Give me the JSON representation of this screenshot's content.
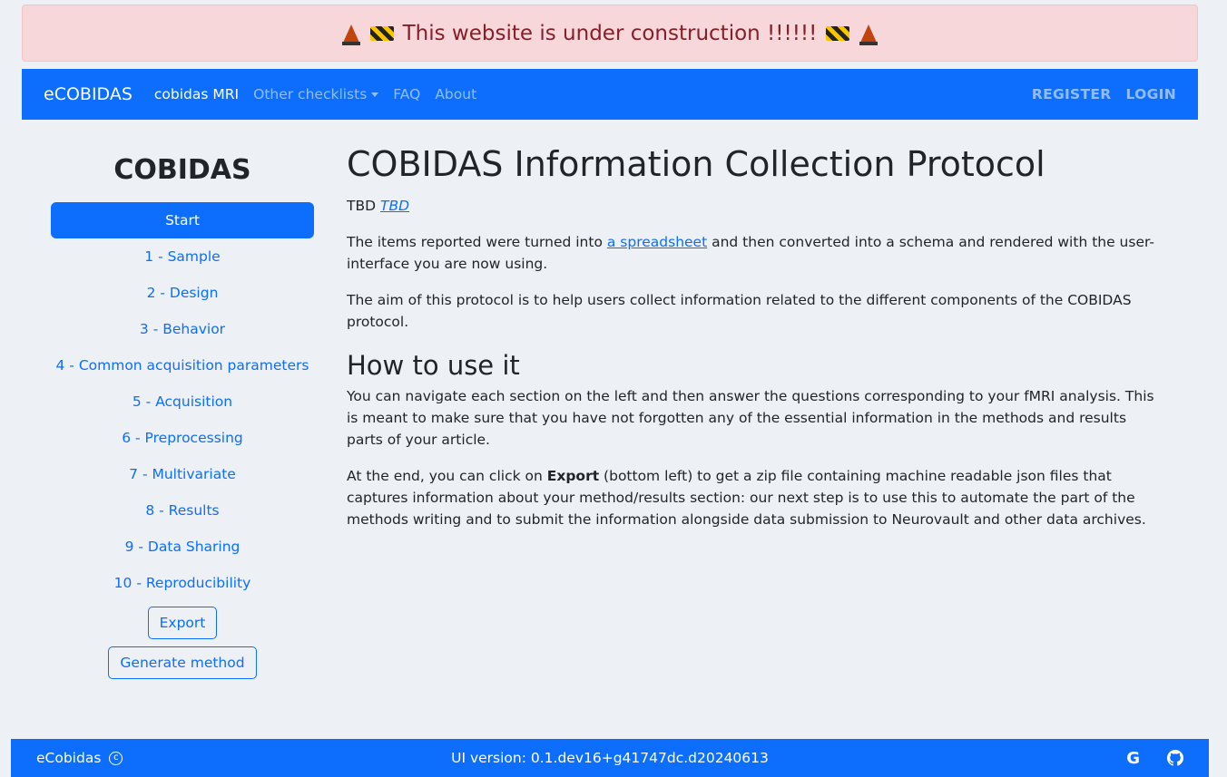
{
  "banner": {
    "text": "This website is under construction !!!!!!"
  },
  "navbar": {
    "brand": "eCOBIDAS",
    "links": [
      "cobidas MRI",
      "Other checklists",
      "FAQ",
      "About"
    ],
    "register": "REGISTER",
    "login": "LOGIN"
  },
  "sidebar": {
    "title": "COBIDAS",
    "items": [
      "Start",
      "1 - Sample",
      "2 - Design",
      "3 - Behavior",
      "4 - Common acquisition parameters",
      "5 - Acquisition",
      "6 - Preprocessing",
      "7 - Multivariate",
      "8 - Results",
      "9 - Data Sharing",
      "10 - Reproducibility"
    ],
    "export_label": "Export",
    "generate_label": "Generate method"
  },
  "main": {
    "title": "COBIDAS Information Collection Protocol",
    "tbd_text": "TBD",
    "tbd_link": "TBD",
    "p1_before": "The items reported were turned into ",
    "p1_link": "a spreadsheet",
    "p1_after": " and then converted into a schema and rendered with the user-interface you are now using.",
    "p2": "The aim of this protocol is to help users collect information related to the different components of the COBIDAS protocol.",
    "h2": "How to use it",
    "p3": "You can navigate each section on the left and then answer the questions corresponding to your fMRI analysis. This is meant to make sure that you have not forgotten any of the essential information in the methods and results parts of your article.",
    "p4_before": "At the end, you can click on ",
    "p4_bold": "Export",
    "p4_after": " (bottom left) to get a zip file containing machine readable json files that captures information about your method/results section: our next step is to use this to automate the part of the methods writing and to submit the information alongside data submission to Neurovault and other data archives."
  },
  "footer": {
    "left": "eCobidas",
    "copyright_symbol": "c",
    "version": "UI version: 0.1.dev16+g41747dc.d20240613",
    "google_icon": "google-icon",
    "github_icon": "github-icon"
  }
}
